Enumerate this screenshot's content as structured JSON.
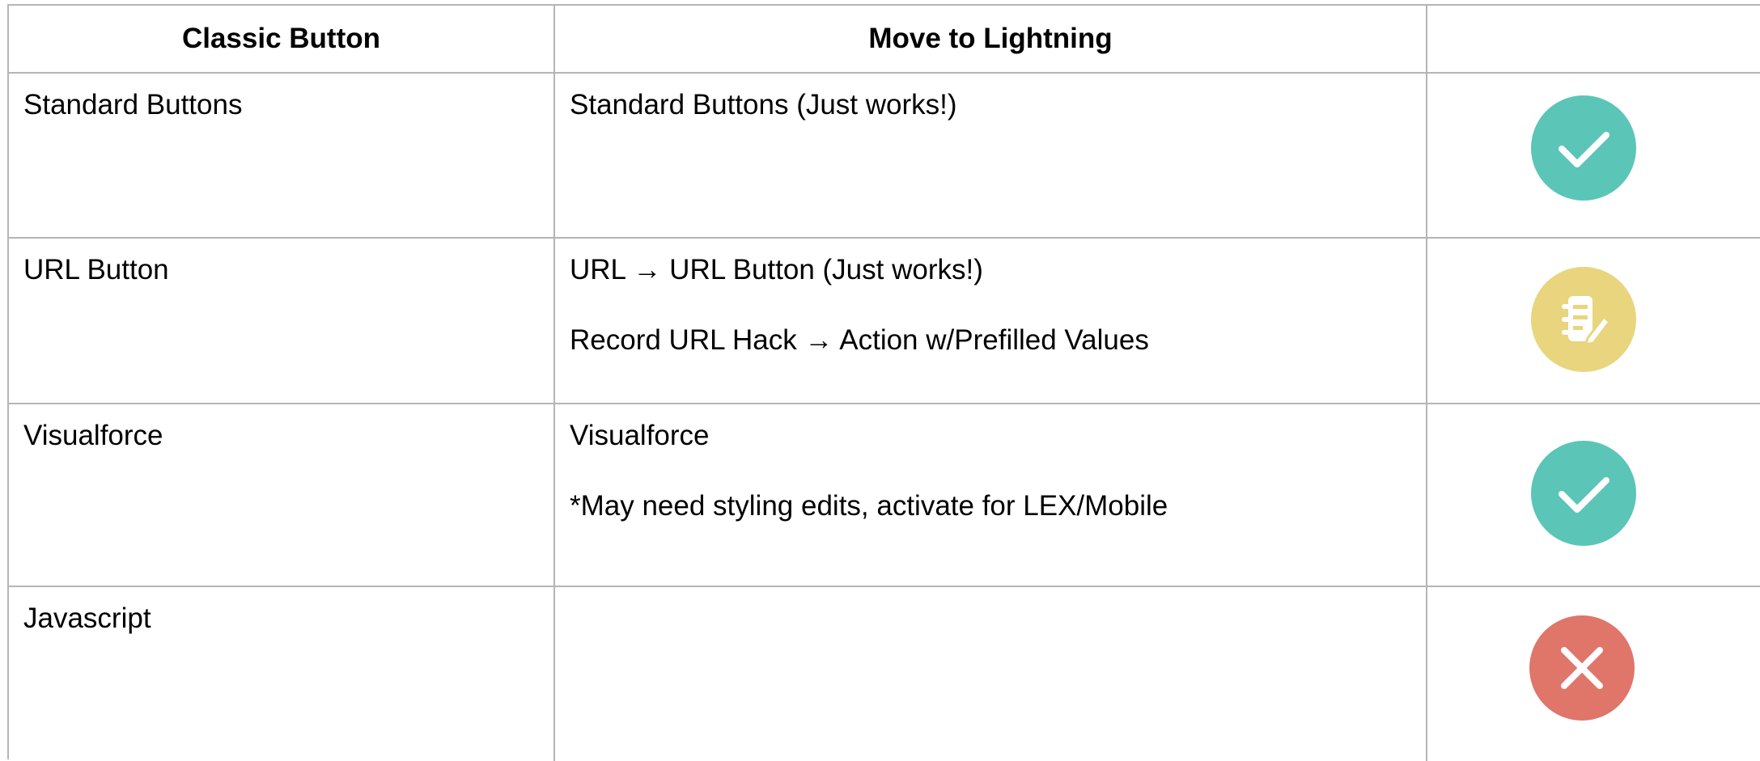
{
  "header": {
    "col1": "Classic Button",
    "col2": "Move to Lightning",
    "col3": ""
  },
  "rows": [
    {
      "classic": "Standard Buttons",
      "lightning": [
        "Standard Buttons (Just works!)"
      ],
      "status": "check-icon",
      "status_color": "#5bc5b7"
    },
    {
      "classic": "URL Button",
      "lightning": [
        "URL → URL Button (Just works!)",
        "Record URL Hack → Action w/Prefilled Values"
      ],
      "status": "edit-note-icon",
      "status_color": "#e8d57e"
    },
    {
      "classic": "Visualforce",
      "lightning": [
        "Visualforce",
        "*May need styling edits, activate for LEX/Mobile"
      ],
      "status": "check-icon",
      "status_color": "#5bc5b7"
    },
    {
      "classic": "Javascript",
      "lightning": [],
      "status": "close-icon",
      "status_color": "#e0756a"
    }
  ]
}
